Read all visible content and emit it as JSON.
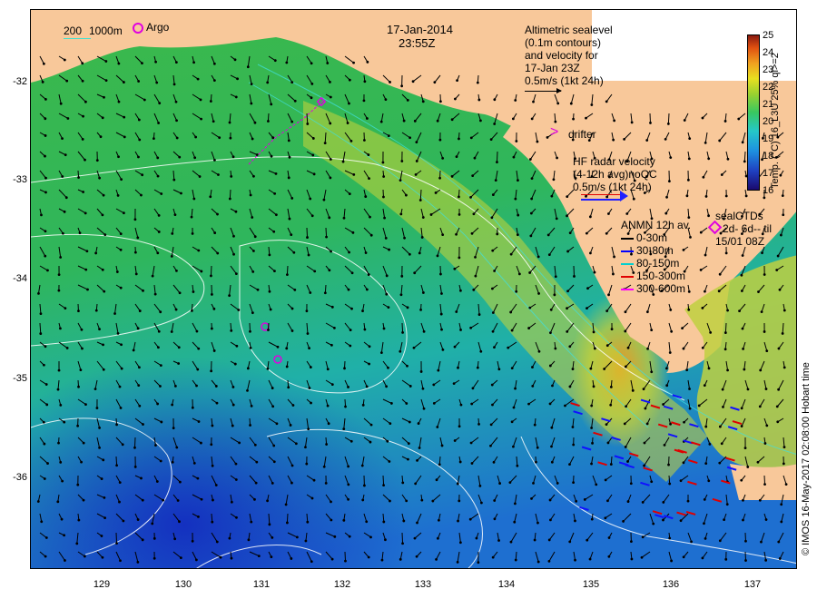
{
  "title": {
    "date": "17-Jan-2014",
    "time": "23:55Z"
  },
  "depth_legend": {
    "contour_200": "200",
    "contour_1000": "1000m"
  },
  "argo_label": "Argo",
  "altimetry_note": [
    "Altimetric sealevel",
    "(0.1m contours)",
    "and velocity for",
    "17-Jan 23Z",
    "0.5m/s (1kt 24h)"
  ],
  "drifter_label": "drifter",
  "hf_radar_note": [
    "HF radar velocity",
    "(4-12h avg)noQC",
    "0.5m/s (1kt 24h)"
  ],
  "anmn_legend": {
    "title": "ANMN 12h av.",
    "items": [
      {
        "label": "0-30m",
        "color": "#000000"
      },
      {
        "label": "30-80m",
        "color": "#0000ff"
      },
      {
        "label": "80-150m",
        "color": "#00d0d0"
      },
      {
        "label": "150-300m",
        "color": "#e00000"
      },
      {
        "label": "300-600m",
        "color": "#ff00ff"
      }
    ]
  },
  "seal_ctd": {
    "title": "sealCTDs",
    "line1": "2d- 6d-- til",
    "line2": "15/01 08Z"
  },
  "colorbar": {
    "title": "Temp. (°C) 16_L3U 25% ql>=2",
    "ticks": [
      "25",
      "24",
      "23",
      "22",
      "21",
      "20",
      "19",
      "18",
      "17",
      "16"
    ],
    "min": 16,
    "max": 25
  },
  "credit": "© IMOS 16-May-2017 02:08:00 Hobart time",
  "axes": {
    "x_ticks": [
      "129",
      "130",
      "131",
      "132",
      "133",
      "134",
      "135",
      "136",
      "137"
    ],
    "y_ticks": [
      "-32",
      "-33",
      "-34",
      "-35",
      "-36"
    ],
    "lon_range": [
      128.2,
      137.5
    ],
    "lat_range": [
      -36.95,
      -31.3
    ]
  },
  "colors": {
    "land": "#f8c89a",
    "current_arrow": "#000000",
    "contour": "#ffffff",
    "argo": "#e000e0"
  }
}
